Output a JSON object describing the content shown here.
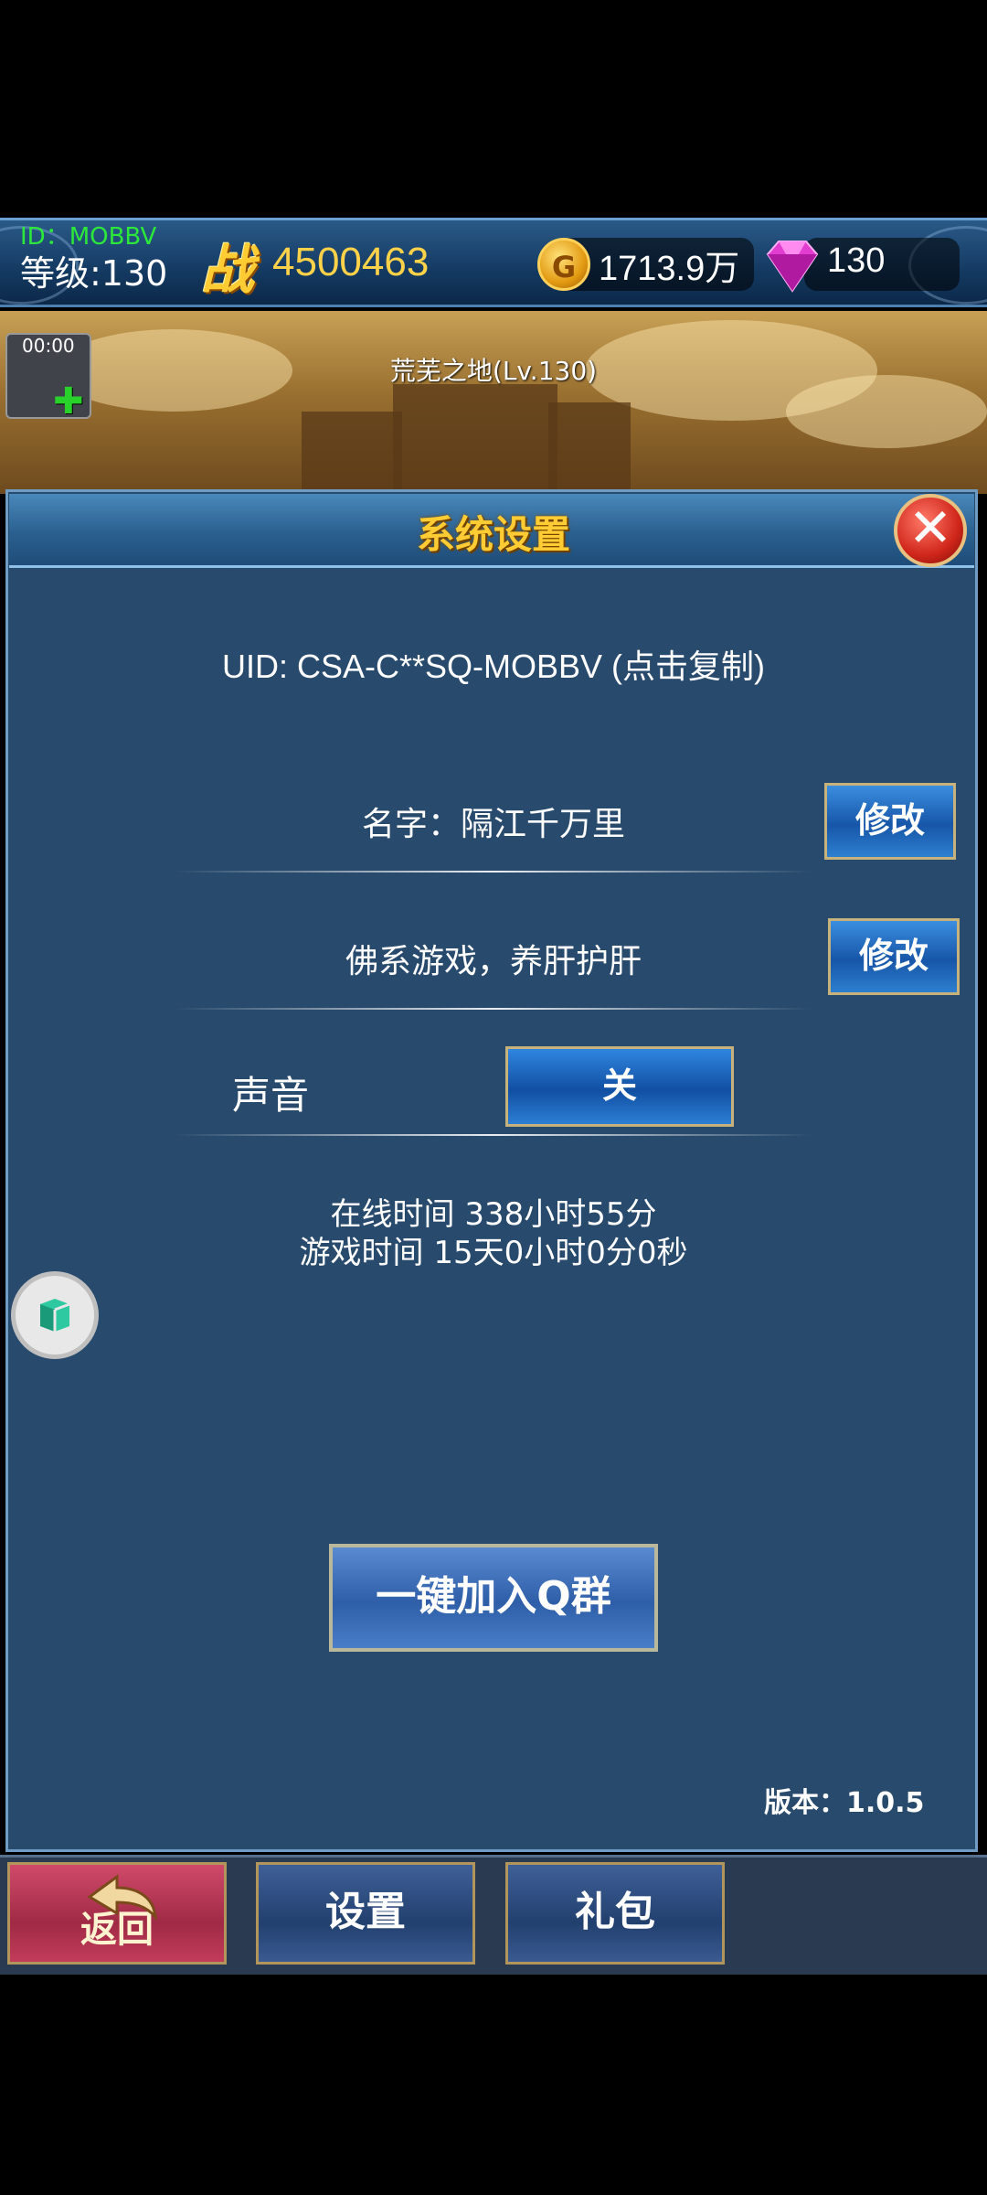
{
  "header": {
    "id_text": "ID：MOBBV",
    "level_text": "等级:130",
    "power_icon_char": "战",
    "power_value": "4500463",
    "gold_icon_char": "G",
    "gold_value": "1713.9万",
    "gem_value": "130"
  },
  "scene": {
    "timer": "00:00",
    "map_name": "荒芜之地(Lv.130)"
  },
  "panel": {
    "title": "系统设置",
    "close_icon": "✕",
    "uid_text": "UID: CSA-C**SQ-MOBBV (点击复制)",
    "name_label": "名字：隔江千万里",
    "name_edit_label": "修改",
    "motto_label": "佛系游戏，养肝护肝",
    "motto_edit_label": "修改",
    "sound_label": "声音",
    "sound_toggle_label": "关",
    "online_time": "在线时间 338小时55分",
    "play_time": "游戏时间 15天0小时0分0秒",
    "qgroup_button": "一键加入Q群",
    "version": "版本：1.0.5"
  },
  "bottom_nav": {
    "back_label": "返回",
    "settings_label": "设置",
    "gift_label": "礼包"
  },
  "colors": {
    "gold_accent": "#ffcc33",
    "id_green": "#2ce83a",
    "panel_bg": "#284a6c"
  }
}
